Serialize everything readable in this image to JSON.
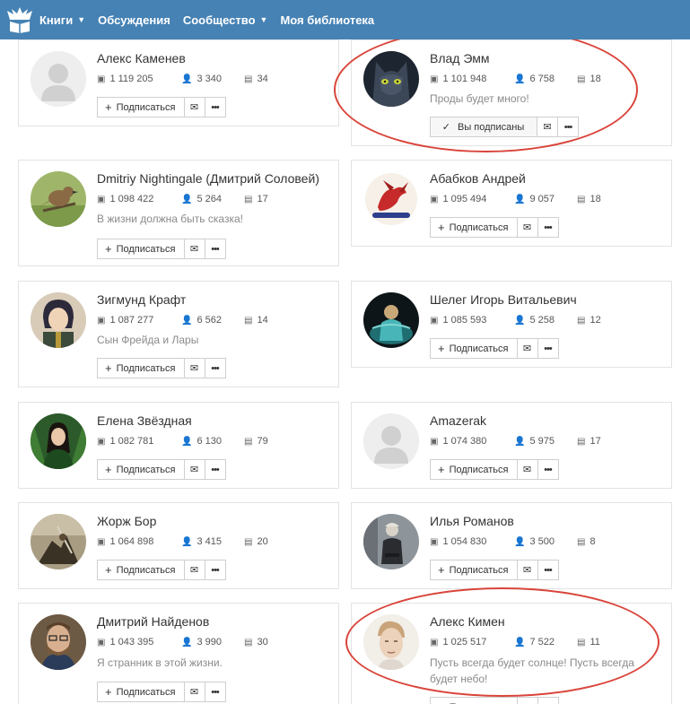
{
  "nav": {
    "items": [
      {
        "label": "Книги",
        "dropdown": true
      },
      {
        "label": "Обсуждения",
        "dropdown": false
      },
      {
        "label": "Сообщество",
        "dropdown": true
      },
      {
        "label": "Моя библиотека",
        "dropdown": false
      }
    ],
    "colors": {
      "navbar": "#4682b4",
      "highlight": "#d9443a"
    }
  },
  "buttons": {
    "subscribe": "Подписаться",
    "subscribed": "Вы подписаны"
  },
  "authors": [
    {
      "name": "Алекс Каменев",
      "views": "1 119 205",
      "followers": "3 340",
      "books": "34",
      "status": "",
      "subscribed": false,
      "avatar": "placeholder"
    },
    {
      "name": "Влад Эмм",
      "views": "1 101 948",
      "followers": "6 758",
      "books": "18",
      "status": "Проды будет много!",
      "subscribed": true,
      "avatar": "cat"
    },
    {
      "name": "Dmitriy Nightingale (Дмитрий Соловей)",
      "views": "1 098 422",
      "followers": "5 264",
      "books": "17",
      "status": "В жизни должна быть сказка!",
      "subscribed": false,
      "avatar": "bird"
    },
    {
      "name": "Абабков Андрей",
      "views": "1 095 494",
      "books": "18",
      "followers": "9 057",
      "status": "",
      "subscribed": false,
      "avatar": "dragon"
    },
    {
      "name": "Зигмунд Крафт",
      "views": "1 087 277",
      "followers": "6 562",
      "books": "14",
      "status": "Сын Фрейда и Лары",
      "subscribed": false,
      "avatar": "anime"
    },
    {
      "name": "Шелег Игорь Витальевич",
      "views": "1 085 593",
      "followers": "5 258",
      "books": "12",
      "status": "",
      "subscribed": false,
      "avatar": "cyan-figure"
    },
    {
      "name": "Елена Звёздная",
      "views": "1 082 781",
      "followers": "6 130",
      "books": "79",
      "status": "",
      "subscribed": false,
      "avatar": "forest-girl"
    },
    {
      "name": "Amazerak",
      "views": "1 074 380",
      "followers": "5 975",
      "books": "17",
      "status": "",
      "subscribed": false,
      "avatar": "placeholder"
    },
    {
      "name": "Жорж Бор",
      "views": "1 064 898",
      "followers": "3 415",
      "books": "20",
      "status": "",
      "subscribed": false,
      "avatar": "warrior"
    },
    {
      "name": "Илья Романов",
      "views": "1 054 830",
      "followers": "3 500",
      "books": "8",
      "status": "",
      "subscribed": false,
      "avatar": "sitting-man"
    },
    {
      "name": "Дмитрий Найденов",
      "views": "1 043 395",
      "followers": "3 990",
      "books": "30",
      "status": "Я странник в этой жизни.",
      "subscribed": false,
      "avatar": "man-glasses"
    },
    {
      "name": "Алекс Кимен",
      "views": "1 025 517",
      "followers": "7 522",
      "books": "11",
      "status": "Пусть всегда будет солнце! Пусть всегда будет небо!",
      "subscribed": false,
      "avatar": "sketch-face"
    }
  ]
}
